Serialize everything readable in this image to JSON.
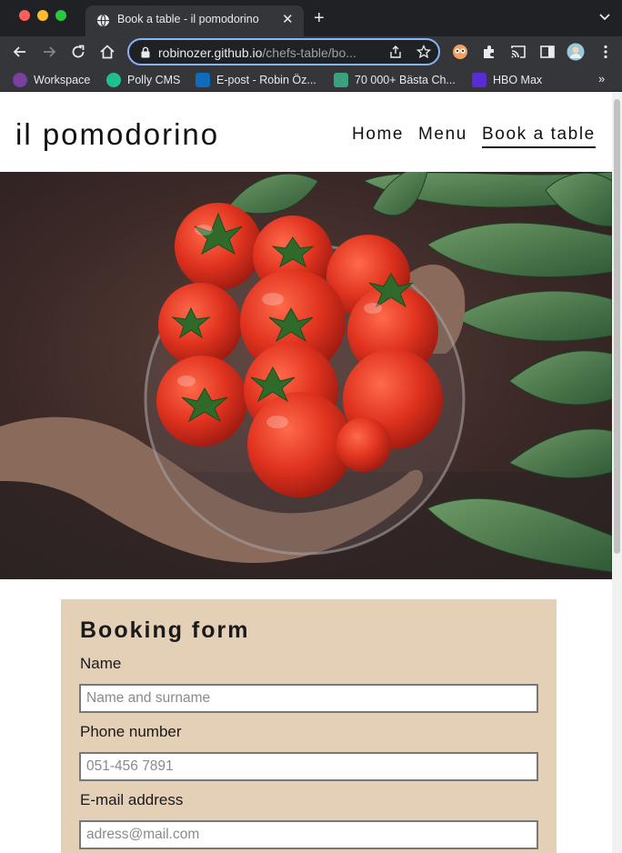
{
  "browser": {
    "tab_title": "Book a table - il pomodorino",
    "tab_close": "✕",
    "new_tab": "+",
    "url_host": "robinozer.github.io",
    "url_path": "/chefs-table/bo...",
    "bookmarks": [
      {
        "label": "Workspace",
        "color": "#7b3fa0"
      },
      {
        "label": "Polly CMS",
        "color": "#1fbf8f"
      },
      {
        "label": "E-post - Robin Öz...",
        "color": "#0f6cbd"
      },
      {
        "label": "70 000+ Bästa Ch...",
        "color": "#3aa17e"
      },
      {
        "label": "HBO Max",
        "color": "#5b2bd6"
      }
    ],
    "bookmarks_more": "»"
  },
  "site": {
    "logo": "il pomodorino",
    "nav": [
      {
        "label": "Home"
      },
      {
        "label": "Menu"
      },
      {
        "label": "Book a table",
        "active": true
      }
    ]
  },
  "form": {
    "title": "Booking form",
    "fields": [
      {
        "label": "Name",
        "placeholder": "Name and surname",
        "value": ""
      },
      {
        "label": "Phone number",
        "placeholder": "051-456 7891",
        "value": ""
      },
      {
        "label": "E-mail address",
        "placeholder": "adress@mail.com",
        "value": ""
      }
    ]
  },
  "colors": {
    "form_background": "#e4cfb7",
    "accent_focus": "#8ab4f8"
  }
}
